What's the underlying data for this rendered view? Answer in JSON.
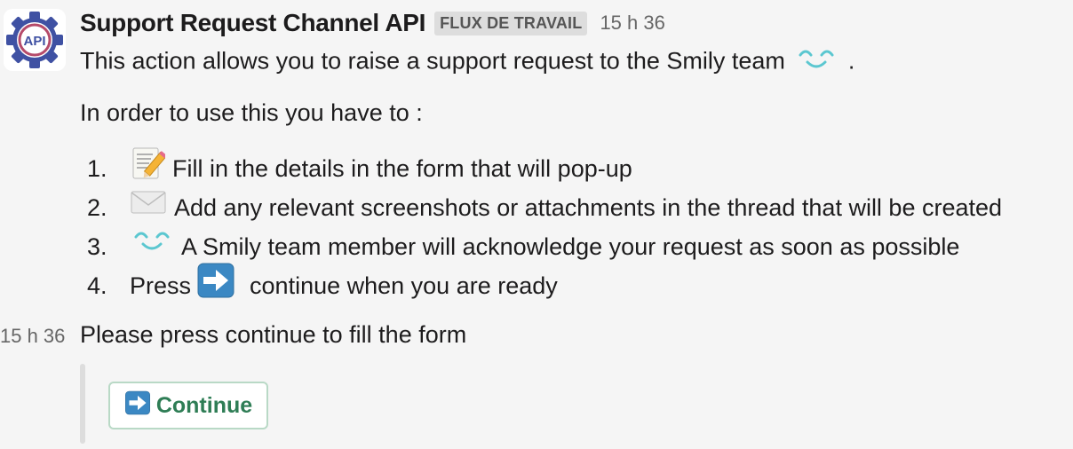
{
  "message": {
    "app_name": "Support Request Channel API",
    "badge": "FLUX DE TRAVAIL",
    "time": "15 h 36",
    "avatar_icon": "api-gear-icon",
    "avatar_label": "API",
    "intro": "This action allows you to raise a support request to the Smily team",
    "intro_end": ".",
    "subtitle": "In order to use this you have to  :",
    "steps": [
      {
        "number": "1.",
        "icon": "memo-icon",
        "text": "Fill in the details in the form that will pop-up"
      },
      {
        "number": "2.",
        "icon": "envelope-icon",
        "text": "Add any relevant screenshots or attachments in the thread that will be created"
      },
      {
        "number": "3.",
        "icon": "smily-icon",
        "text": "A Smily team member will acknowledge your request as soon as possible"
      },
      {
        "number": "4.",
        "icon": "right-arrow-icon",
        "text_before": "Press",
        "text_after": "continue when you are ready"
      }
    ]
  },
  "followup": {
    "time": "15 h 36",
    "text": "Please press continue to fill the form",
    "button_label": "Continue",
    "button_icon": "right-arrow-icon"
  },
  "colors": {
    "background": "#f5f5f5",
    "badge_bg": "#dddddd",
    "button_text": "#2e7d55",
    "button_border": "#b9d9c6",
    "arrow_blue": "#3b88c3",
    "avatar_ring": "#b54a6a",
    "avatar_gear": "#3f51a3"
  }
}
